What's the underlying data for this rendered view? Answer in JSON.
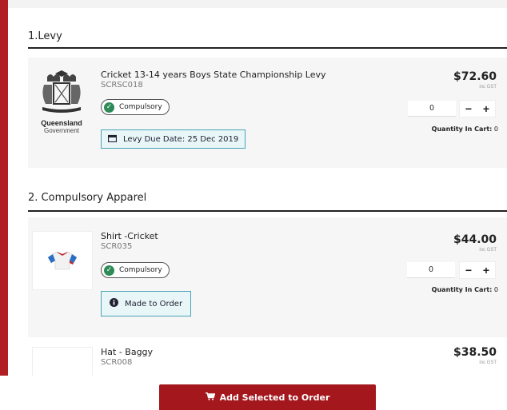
{
  "sections": [
    {
      "title": "1.Levy",
      "items": [
        {
          "name": "Cricket 13-14 years Boys State Championship Levy",
          "code": "SCRSC018",
          "badge": "Compulsory",
          "info": "Levy Due Date: 25 Dec 2019",
          "info_icon": "calendar-icon",
          "price": "$72.60",
          "tax_note": "inc GST",
          "quantity": "0",
          "qty_in_cart_label": "Quantity In Cart:",
          "qty_in_cart_value": "0",
          "logo_text_1": "Queensland",
          "logo_text_2": "Government"
        }
      ]
    },
    {
      "title": "2. Compulsory Apparel",
      "items": [
        {
          "name": "Shirt -Cricket",
          "code": "SCR035",
          "badge": "Compulsory",
          "info": "Made to Order",
          "info_icon": "info-icon",
          "price": "$44.00",
          "tax_note": "inc GST",
          "quantity": "0",
          "qty_in_cart_label": "Quantity In Cart:",
          "qty_in_cart_value": "0"
        },
        {
          "name": "Hat - Baggy",
          "code": "SCR008",
          "price": "$38.50",
          "tax_note": "inc GST"
        }
      ]
    }
  ],
  "stepper": {
    "minus": "−",
    "plus": "+"
  },
  "add_button": {
    "label": "Add Selected to Order",
    "icon": "cart-icon"
  },
  "colors": {
    "brand_red": "#a3171d",
    "left_bar": "#b01f24",
    "check_green": "#2e8b57",
    "info_border": "#4aa3b5"
  }
}
